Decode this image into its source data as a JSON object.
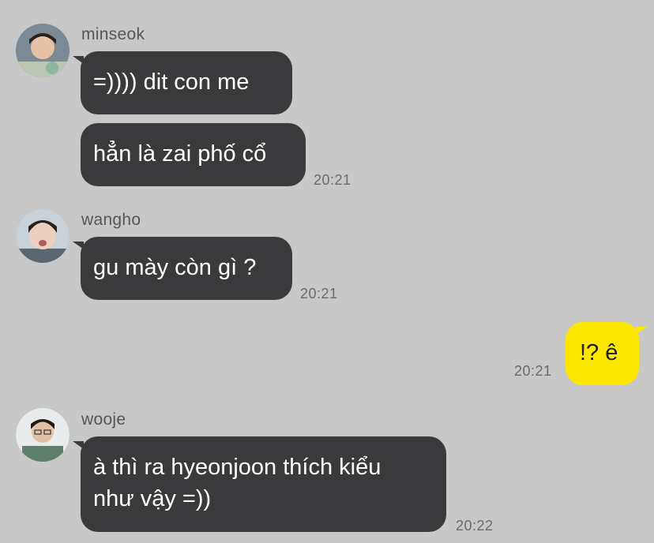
{
  "colors": {
    "background": "#c8c8c8",
    "incoming_bubble": "#3a3a3c",
    "outgoing_bubble": "#fde700"
  },
  "messages": [
    {
      "sender": "minseok",
      "avatar_icon": "user-avatar-icon",
      "texts": [
        "=)))) dit con me",
        "hẳn là zai phố cổ"
      ],
      "time": "20:21"
    },
    {
      "sender": "wangho",
      "avatar_icon": "user-avatar-icon",
      "texts": [
        "gu mày còn gì ?"
      ],
      "time": "20:21"
    },
    {
      "sender": "me",
      "texts": [
        "!? ê"
      ],
      "time": "20:21"
    },
    {
      "sender": "wooje",
      "avatar_icon": "user-avatar-icon",
      "texts": [
        "à thì ra hyeonjoon thích kiểu\nnhư vậy =))"
      ],
      "time": "20:22"
    }
  ]
}
